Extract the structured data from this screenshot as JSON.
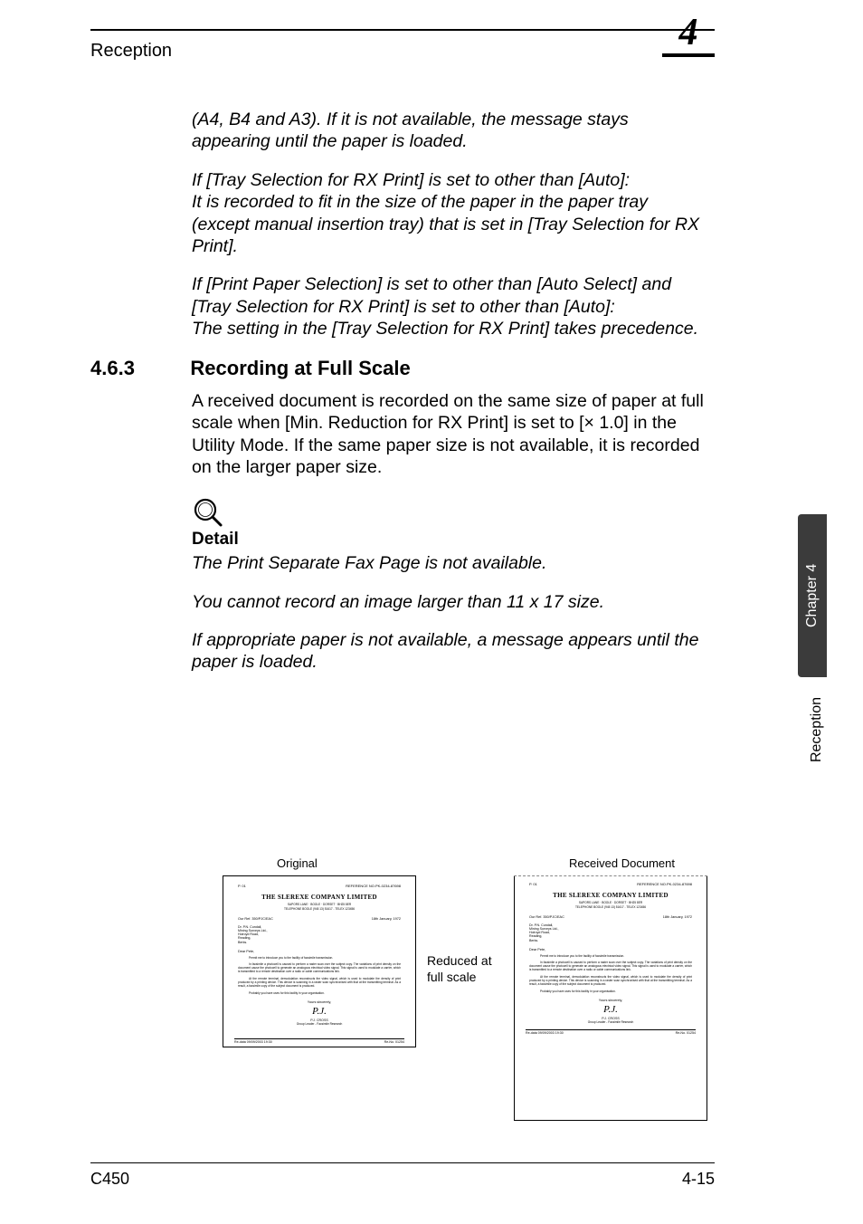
{
  "header": {
    "title": "Reception",
    "chapter_num": "4"
  },
  "notes": {
    "n1_p1": "(A4, B4 and A3). If it is not available, the message stays appearing until the paper is loaded.",
    "n1_p2": "If [Tray Selection for RX Print] is set to other than [Auto]:",
    "n1_p3": "It is recorded to fit in the size of the paper in the paper tray (except manual insertion tray) that is set in [Tray Selection for RX Print].",
    "n1_p4": "If [Print Paper Selection] is set to other than [Auto Select] and [Tray Selection for RX Print] is set to other than [Auto]:",
    "n1_p5": "The setting in the [Tray Selection for RX Print] takes precedence."
  },
  "section": {
    "num": "4.6.3",
    "title": "Recording at Full Scale",
    "para": "A received document is recorded on the same size of paper at full scale when [Min. Reduction for RX Print] is set to [× 1.0] in the Utility Mode. If the same paper size is not available, it is recorded on the larger paper size."
  },
  "detail": {
    "label": "Detail",
    "p1": "The Print Separate Fax Page is not available.",
    "p2": "You cannot record an image larger than 11 x 17 size.",
    "p3": "If appropriate paper is not available, a message appears until the paper is loaded."
  },
  "diagram": {
    "left_label": "Original",
    "right_label": "Received Document",
    "mid1": "Reduced at",
    "mid2": "full scale",
    "doc": {
      "page_ind": "P. 01",
      "refnum": "REFERENCE NO.PK-0234-87698",
      "company": "THE SLEREXE COMPANY LIMITED",
      "sub1": "SAPORS LANE · BOOLE · DORSET · BH25 8ER",
      "sub2": "TELEPHONE BOOLE (945 13) 51617 - TELEX 123456",
      "ref": "Our Ref. 350/PJC/EAC",
      "date": "18th January, 1972",
      "addr": "Dr. P.N. Cundall,\nMining Surveys Ltd.,\nHolroyd Road,\nReading,\nBerks.",
      "dear": "Dear Pete,",
      "lead": "Permit me to introduce you to the facility of facsimile transmission.",
      "para1": "In facsimile a photocell is caused to perform a raster scan over the subject copy. The variations of print density on the document cause the photocell to generate an analogous electrical video signal. This signal is used to modulate a carrier, which is transmitted to a remote destination over a radio or cable communications link.",
      "para2": "At the remote terminal, demodulation reconstructs the video signal, which is used to modulate the density of print produced by a printing device. This device is scanning in a raster scan synchronised with that at the transmitting terminal. As a result, a facsimile copy of the subject document is produced.",
      "para3": "Probably you have uses for this facility in your organisation.",
      "closing": "Yours sincerely,",
      "sig": "P.J.",
      "signame": "P.J. CROSS",
      "sigtitle": "Group Leader - Facsimile Research",
      "foot1": "Re-data 09/09/2003   19:30",
      "foot2": "Re-No. 01254"
    }
  },
  "sidebar": {
    "tab": "Chapter 4",
    "label": "Reception"
  },
  "footer": {
    "left": "C450",
    "right": "4-15"
  }
}
